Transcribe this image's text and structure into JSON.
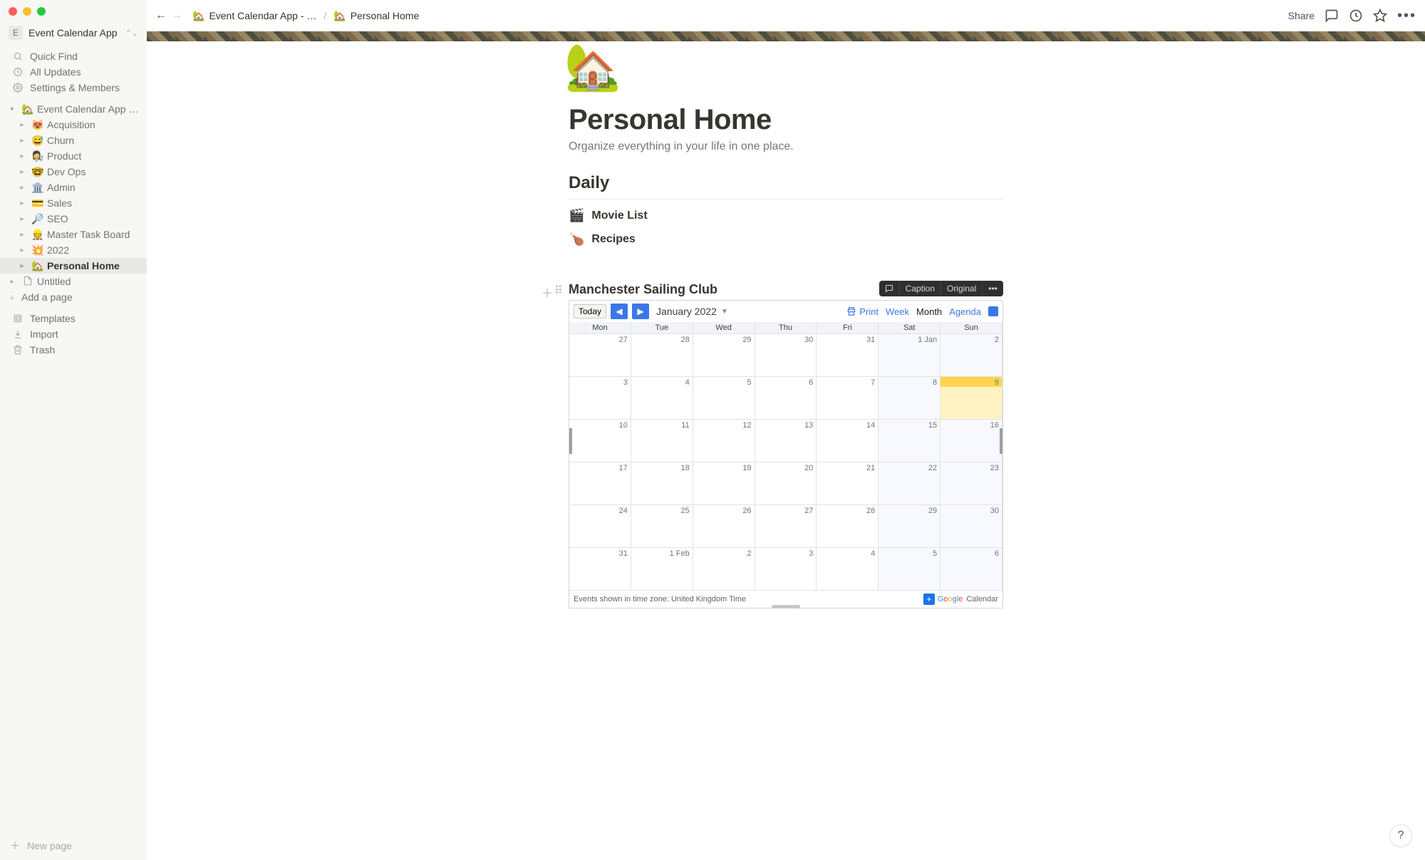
{
  "workspace": {
    "avatar": "E",
    "name": "Event Calendar App"
  },
  "sidebar_top": {
    "quick_find": "Quick Find",
    "all_updates": "All Updates",
    "settings": "Settings & Members"
  },
  "tree": {
    "root": {
      "emoji": "🏡",
      "label": "Event Calendar App - …"
    },
    "children": [
      {
        "emoji": "😻",
        "label": "Acquisition"
      },
      {
        "emoji": "😅",
        "label": "Churn"
      },
      {
        "emoji": "👩‍🔬",
        "label": "Product"
      },
      {
        "emoji": "🤓",
        "label": "Dev Ops"
      },
      {
        "emoji": "🏛️",
        "label": "Admin"
      },
      {
        "emoji": "💳",
        "label": "Sales"
      },
      {
        "emoji": "🔎",
        "label": "SEO"
      },
      {
        "emoji": "👷",
        "label": "Master Task Board"
      },
      {
        "emoji": "💥",
        "label": "2022"
      },
      {
        "emoji": "🏡",
        "label": "Personal Home",
        "active": true
      }
    ],
    "untitled": {
      "emoji": "📄",
      "label": "Untitled"
    },
    "add_page": "Add a page"
  },
  "sidebar_bottom": {
    "templates": "Templates",
    "import": "Import",
    "trash": "Trash"
  },
  "footer": {
    "new_page": "New page"
  },
  "topbar": {
    "share": "Share",
    "crumb1": {
      "emoji": "🏡",
      "label": "Event Calendar App - …"
    },
    "crumb2": {
      "emoji": "🏡",
      "label": "Personal Home"
    }
  },
  "page": {
    "emoji": "🏡",
    "title": "Personal Home",
    "subtitle": "Organize everything in your life in one place.",
    "section": "Daily",
    "links": [
      {
        "emoji": "🎬",
        "label": "Movie List"
      },
      {
        "emoji": "🍗",
        "label": "Recipes"
      }
    ]
  },
  "embed_toolbar": {
    "caption": "Caption",
    "original": "Original"
  },
  "calendar": {
    "title": "Manchester Sailing Club",
    "today": "Today",
    "month_label": "January 2022",
    "print": "Print",
    "views": {
      "week": "Week",
      "month": "Month",
      "agenda": "Agenda"
    },
    "day_headers": [
      "Mon",
      "Tue",
      "Wed",
      "Thu",
      "Fri",
      "Sat",
      "Sun"
    ],
    "rows": [
      [
        "27",
        "28",
        "29",
        "30",
        "31",
        "1 Jan",
        "2"
      ],
      [
        "3",
        "4",
        "5",
        "6",
        "7",
        "8",
        "9"
      ],
      [
        "10",
        "11",
        "12",
        "13",
        "14",
        "15",
        "16"
      ],
      [
        "17",
        "18",
        "19",
        "20",
        "21",
        "22",
        "23"
      ],
      [
        "24",
        "25",
        "26",
        "27",
        "28",
        "29",
        "30"
      ],
      [
        "31",
        "1 Feb",
        "2",
        "3",
        "4",
        "5",
        "6"
      ]
    ],
    "today_index": {
      "row": 1,
      "col": 6
    },
    "tz": "Events shown in time zone: United Kingdom Time",
    "brand": "Calendar"
  },
  "help": "?"
}
